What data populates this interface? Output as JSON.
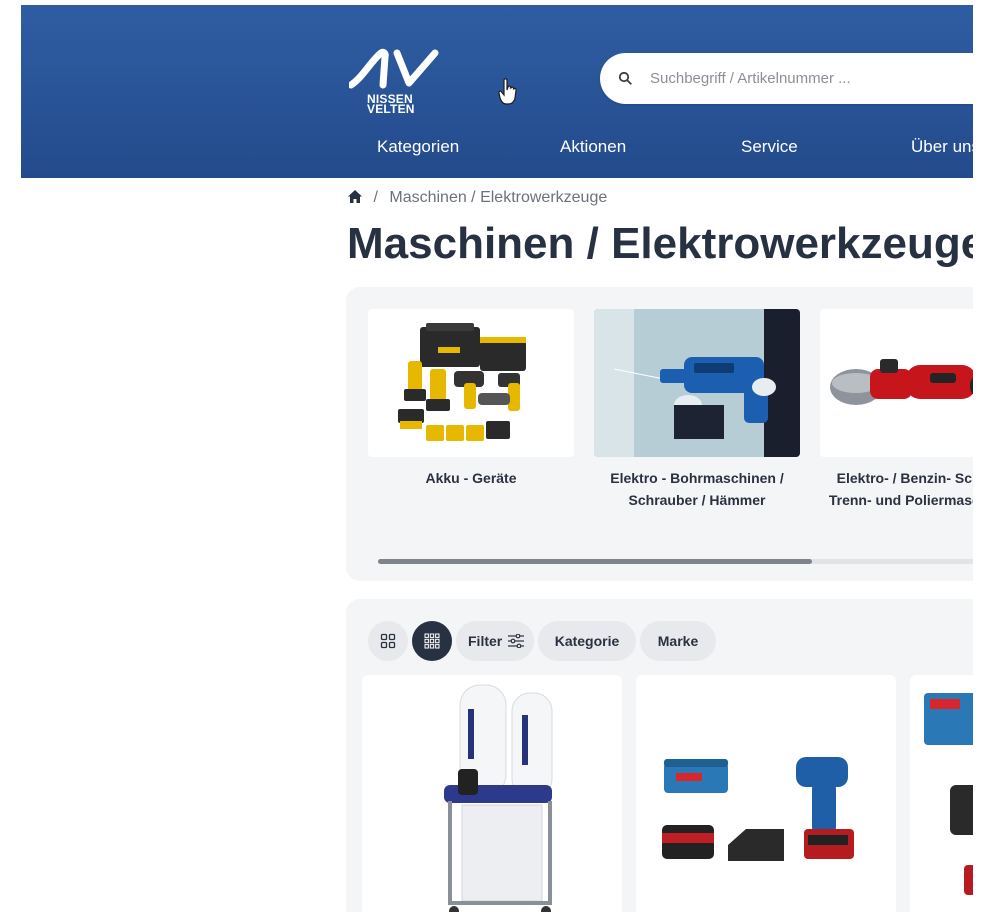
{
  "header": {
    "logo_lines": [
      "NISSEN",
      "VELTEN"
    ],
    "search_placeholder": "Suchbegriff / Artikelnummer ...",
    "nav": [
      "Kategorien",
      "Aktionen",
      "Service",
      "Über uns"
    ]
  },
  "breadcrumb": {
    "separator": "/",
    "current": "Maschinen / Elektrowerkzeuge"
  },
  "page_title": "Maschinen / Elektrowerkzeuge",
  "categories": [
    {
      "label": "Akku - Geräte"
    },
    {
      "label": "Elektro - Bohrmaschinen / Schrauber / Hämmer"
    },
    {
      "label": "Elektro- / Benzin- Schleif-, Trenn- und Poliermaschinen"
    }
  ],
  "category_scroll_progress": 0.62,
  "toolbar": {
    "filter_label": "Filter",
    "category_label": "Kategorie",
    "brand_label": "Marke"
  },
  "colors": {
    "header_blue": "#2a559a",
    "dark_navy": "#283141",
    "panel_gray": "#f4f5f7",
    "chip_gray": "#e7e9ec"
  },
  "icons": [
    "home-icon",
    "search-icon",
    "grid-2-icon",
    "grid-3-icon",
    "sliders-icon",
    "hand-cursor-icon"
  ]
}
